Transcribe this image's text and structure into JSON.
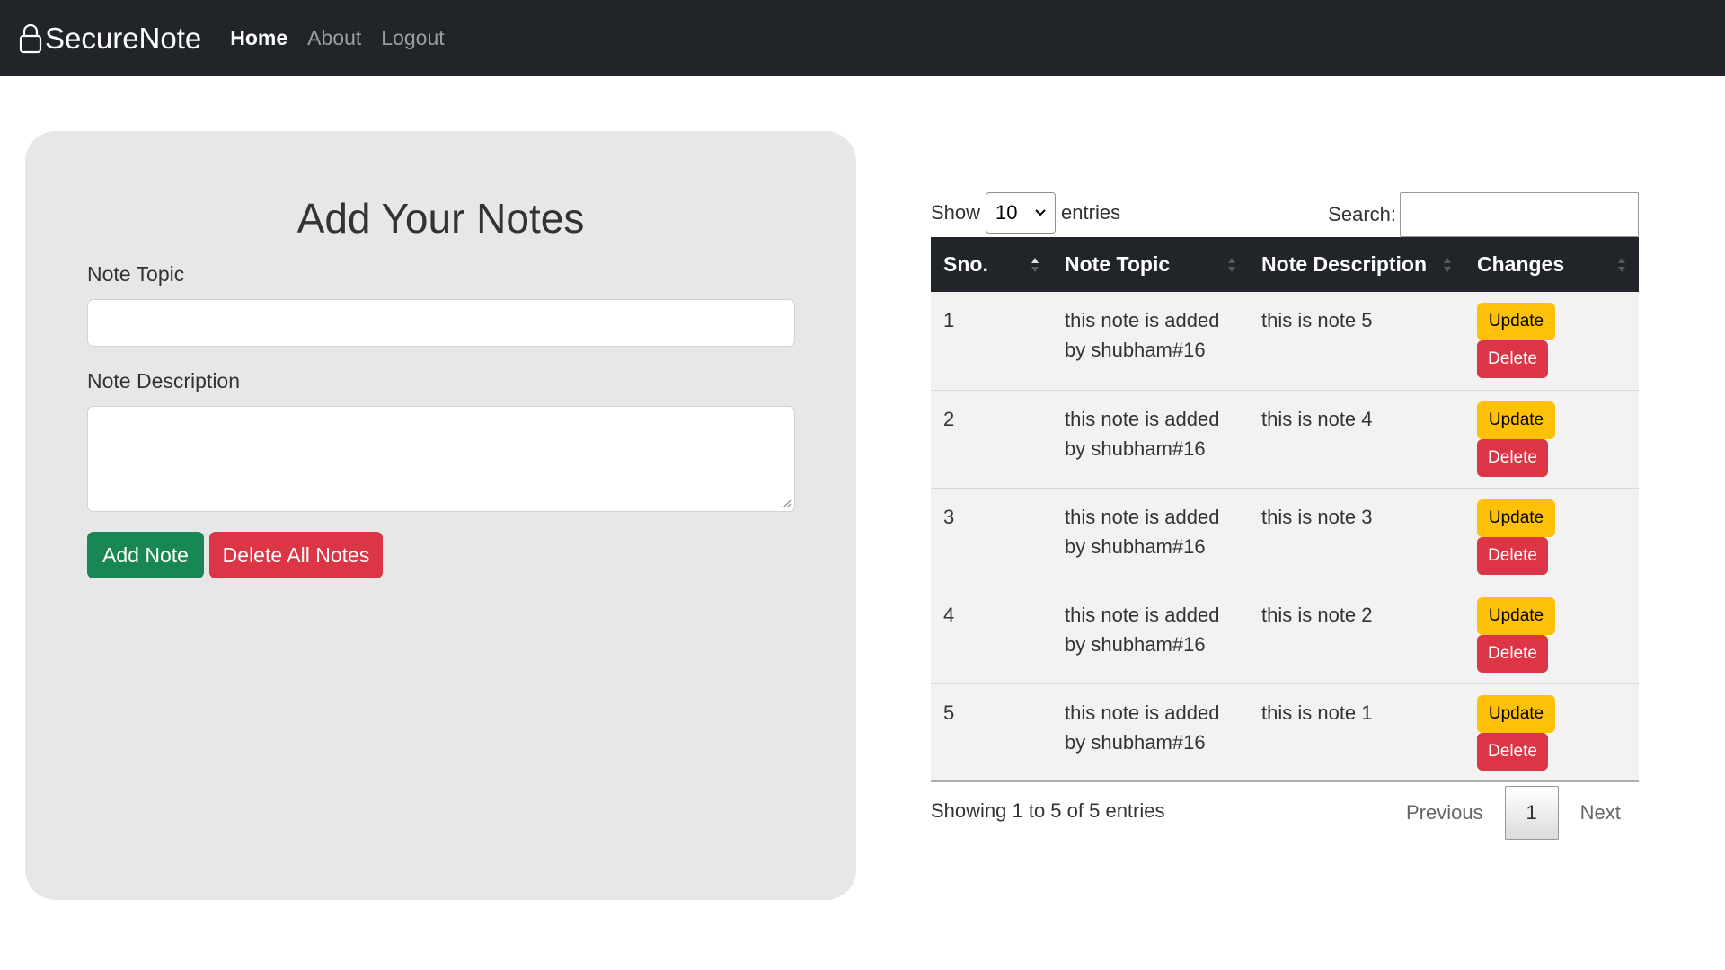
{
  "navbar": {
    "brand": "SecureNote",
    "brand_icon": "lock-icon",
    "links": [
      {
        "label": "Home",
        "active": true
      },
      {
        "label": "About",
        "active": false
      },
      {
        "label": "Logout",
        "active": false
      }
    ]
  },
  "form": {
    "title": "Add Your Notes",
    "topic_label": "Note Topic",
    "topic_value": "",
    "description_label": "Note Description",
    "description_value": "",
    "add_button": "Add Note",
    "delete_all_button": "Delete All Notes"
  },
  "table_controls": {
    "show_label": "Show",
    "entries_value": "10",
    "entries_label": "entries",
    "search_label": "Search:",
    "search_value": ""
  },
  "table": {
    "headers": [
      "Sno.",
      "Note Topic",
      "Note Description",
      "Changes"
    ],
    "rows": [
      {
        "sno": "1",
        "topic_line1": "this note is added",
        "topic_line2": "by shubham#16",
        "description": "this is note 5"
      },
      {
        "sno": "2",
        "topic_line1": "this note is added",
        "topic_line2": "by shubham#16",
        "description": "this is note 4"
      },
      {
        "sno": "3",
        "topic_line1": "this note is added",
        "topic_line2": "by shubham#16",
        "description": "this is note 3"
      },
      {
        "sno": "4",
        "topic_line1": "this note is added",
        "topic_line2": "by shubham#16",
        "description": "this is note 2"
      },
      {
        "sno": "5",
        "topic_line1": "this note is added",
        "topic_line2": "by shubham#16",
        "description": "this is note 1"
      }
    ],
    "update_label": "Update",
    "delete_label": "Delete"
  },
  "footer": {
    "info": "Showing 1 to 5 of 5 entries",
    "previous": "Previous",
    "current_page": "1",
    "next": "Next"
  },
  "colors": {
    "navbar": "#212529",
    "card": "#e7e7e7",
    "success": "#198754",
    "danger": "#dc3545",
    "warning": "#ffc107"
  }
}
